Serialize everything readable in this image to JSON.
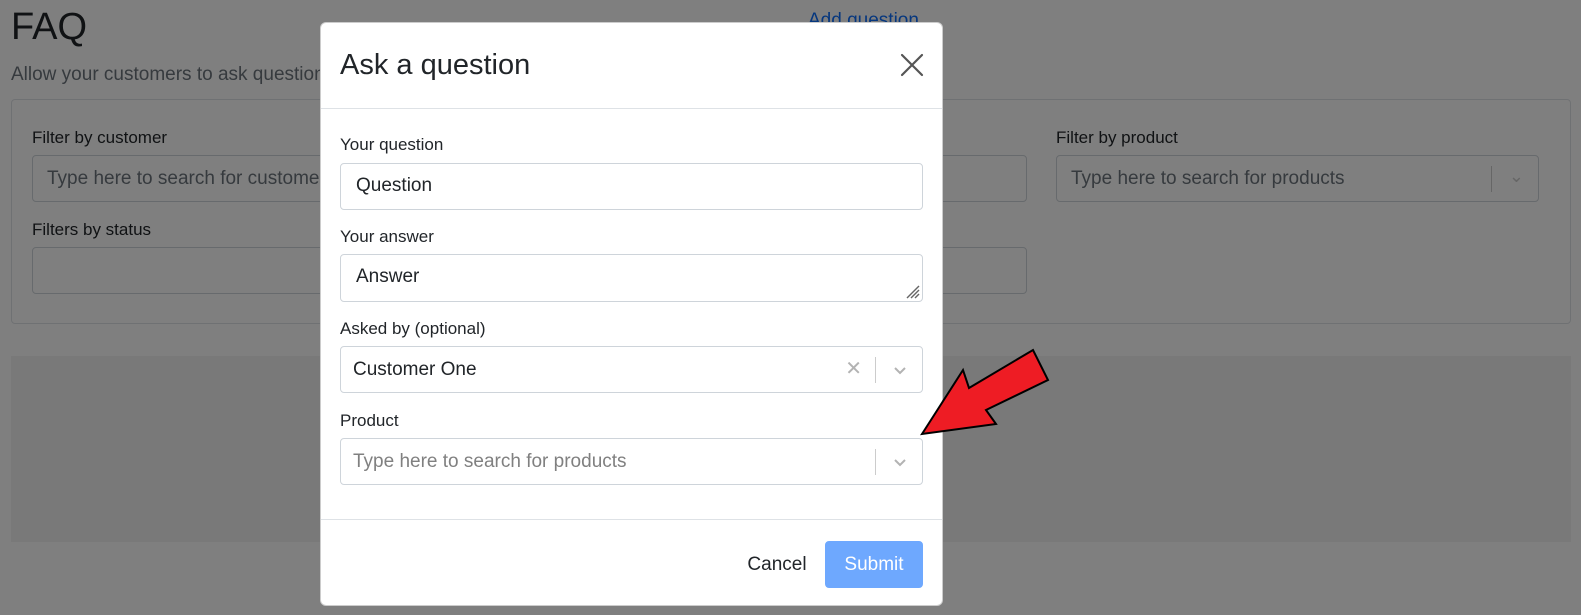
{
  "background": {
    "title": "FAQ",
    "add_link": "Add question",
    "subtitle": "Allow your customers to ask questions",
    "filters": {
      "customer_label": "Filter by customer",
      "customer_placeholder": "Type here to search for customers",
      "product_label": "Filter by product",
      "product_placeholder": "Type here to search for products",
      "status_label": "Filters by status"
    }
  },
  "modal": {
    "title": "Ask a question",
    "question_label": "Your question",
    "question_value": "Question",
    "answer_label": "Your answer",
    "answer_value": "Answer",
    "asked_by_label": "Asked by (optional)",
    "asked_by_value": "Customer One",
    "product_label": "Product",
    "product_placeholder": "Type here to search for products",
    "cancel_label": "Cancel",
    "submit_label": "Submit"
  },
  "colors": {
    "annotation_arrow": "#ee1c24",
    "submit_button": "#6ea8fe",
    "backdrop": "rgba(0,0,0,0.5)"
  },
  "icons": {
    "close": "close-icon",
    "clear": "clear-icon",
    "dropdown": "chevron-down-icon",
    "arrow": "annotation-arrow-icon"
  }
}
